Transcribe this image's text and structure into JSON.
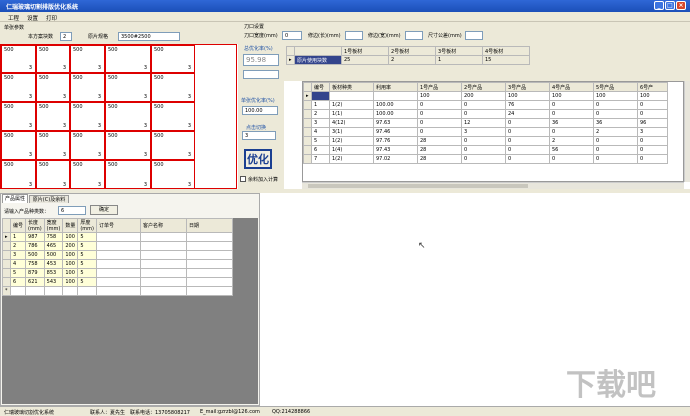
{
  "window": {
    "title": "仁瑞玻璃切割排版优化系统"
  },
  "menu": [
    "工程",
    "设置",
    "打印"
  ],
  "params": {
    "section_label": "单张参数",
    "layout_count_label": "本方案块数",
    "layout_count": "2",
    "sheet_size_label": "原片规格",
    "sheet_size": "3500#2500"
  },
  "cut": {
    "section_label": "刀口设置",
    "blade_label": "刀口宽度(mm)",
    "blade": "0",
    "trim_long_label": "修边(长)(mm)",
    "trim_short_label": "修边(宽)(mm)",
    "size_tol_label": "尺寸公差(mm)"
  },
  "sheet_layout": {
    "rows": [
      [
        {
          "w": "500",
          "h": "3"
        },
        {
          "w": "500",
          "h": "3"
        },
        {
          "w": "500",
          "h": "3"
        },
        {
          "w": "500",
          "h": "3"
        },
        {
          "w": "500",
          "h": "3"
        }
      ],
      [
        {
          "w": "500",
          "h": "3"
        },
        {
          "w": "500",
          "h": "3"
        },
        {
          "w": "500",
          "h": "3"
        },
        {
          "w": "500",
          "h": "3"
        },
        {
          "w": "500",
          "h": "3"
        }
      ],
      [
        {
          "w": "500",
          "h": "3"
        },
        {
          "w": "500",
          "h": "3"
        },
        {
          "w": "500",
          "h": "3"
        },
        {
          "w": "500",
          "h": "3"
        },
        {
          "w": "500",
          "h": "3"
        }
      ],
      [
        {
          "w": "500",
          "h": "3"
        },
        {
          "w": "500",
          "h": "3"
        },
        {
          "w": "500",
          "h": "3"
        },
        {
          "w": "500",
          "h": "3"
        },
        {
          "w": "500",
          "h": "3"
        }
      ],
      [
        {
          "w": "500",
          "h": "3"
        },
        {
          "w": "500",
          "h": "3"
        },
        {
          "w": "500",
          "h": "3"
        },
        {
          "w": "500",
          "h": "3"
        },
        {
          "w": "500",
          "h": "3"
        }
      ]
    ]
  },
  "rate": {
    "overall_label": "总优化率(%)",
    "overall": "95.98",
    "single_label": "单张优化率(%)",
    "single": "100.00",
    "cut_count_label": "点击切换",
    "cut_count": "3",
    "optimize_label": "优化",
    "leftover_label": "余料加入计算"
  },
  "material_table": {
    "headers": [
      "",
      "1号板材",
      "2号板材",
      "3号板材",
      "4号板材"
    ],
    "row_label": "原片使用块数",
    "values": [
      "25",
      "2",
      "1",
      "15"
    ]
  },
  "result_table": {
    "headers": [
      "编号",
      "板材种类",
      "利用率",
      "1号产品",
      "2号产品",
      "3号产品",
      "4号产品",
      "5号产品",
      "6号产"
    ],
    "top_row": [
      "",
      "",
      "",
      "100",
      "200",
      "100",
      "100",
      "100",
      "100"
    ],
    "rows": [
      [
        "1",
        "1(2)",
        "100.00",
        "0",
        "0",
        "76",
        "0",
        "0",
        "0"
      ],
      [
        "2",
        "1(1)",
        "100.00",
        "0",
        "0",
        "24",
        "0",
        "0",
        "0"
      ],
      [
        "3",
        "4(12)",
        "97.63",
        "0",
        "12",
        "0",
        "36",
        "36",
        "96"
      ],
      [
        "4",
        "3(1)",
        "97.46",
        "0",
        "3",
        "0",
        "0",
        "2",
        "3"
      ],
      [
        "5",
        "1(2)",
        "97.76",
        "28",
        "0",
        "0",
        "2",
        "0",
        "0"
      ],
      [
        "6",
        "1(4)",
        "97.43",
        "28",
        "0",
        "0",
        "56",
        "0",
        "0"
      ],
      [
        "7",
        "1(2)",
        "97.02",
        "28",
        "0",
        "0",
        "0",
        "0",
        "0"
      ]
    ]
  },
  "tabs": [
    "产品属性",
    "原片(C)及余料"
  ],
  "product": {
    "count_label": "请输入产品种类数：",
    "count": "6",
    "confirm_label": "确定",
    "headers": [
      "编号",
      "长度\n(mm)",
      "宽度\n(mm)",
      "数量",
      "厚度\n(mm)",
      "订单号",
      "客户名称",
      "日期"
    ],
    "rows": [
      [
        "1",
        "987",
        "758",
        "100",
        "5"
      ],
      [
        "2",
        "786",
        "465",
        "200",
        "5"
      ],
      [
        "3",
        "500",
        "500",
        "100",
        "5"
      ],
      [
        "4",
        "758",
        "453",
        "100",
        "5"
      ],
      [
        "5",
        "879",
        "853",
        "100",
        "5"
      ],
      [
        "6",
        "621",
        "543",
        "100",
        "5"
      ]
    ]
  },
  "status": {
    "app": "仁瑞玻璃切割优化系统",
    "contact": "联系人：夏先生",
    "phone": "联系电话：13705808217",
    "email": "E_mail:gzrzbl@126.com",
    "qq": "QQ:214288866"
  },
  "watermark": "下载吧"
}
